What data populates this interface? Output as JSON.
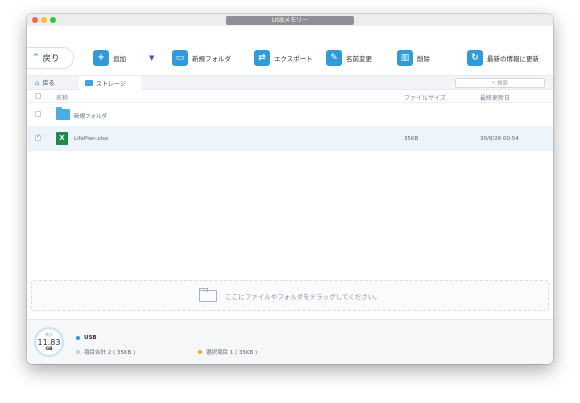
{
  "window": {
    "title": "USBメモリー"
  },
  "toolbar": {
    "back_label": "戻り",
    "add_label": "追加",
    "new_folder_label": "新規フォルダ",
    "export_label": "エクスポート",
    "rename_label": "名前変更",
    "delete_label": "削除",
    "refresh_label": "最新の情報に更新"
  },
  "pathbar": {
    "back_label": "戻る",
    "current_label": "ストレージ",
    "search_placeholder": "検索"
  },
  "table": {
    "headers": {
      "name": "名称",
      "size": "ファイルサイズ",
      "date": "最終更新日"
    },
    "rows": [
      {
        "name": "新規フォルダ",
        "size": "",
        "date": "",
        "icon": "folder-icon",
        "checked": false,
        "selected": false
      },
      {
        "name": "LifePlan.xlsx",
        "size": "35KB",
        "date": "30/8/26  00:54",
        "icon": "excel-file-icon",
        "checked": true,
        "selected": true
      }
    ]
  },
  "dropzone": {
    "text": "ここにファイルやフォルダをドラッグしてください。"
  },
  "status": {
    "gauge_label": "残り",
    "gauge_value": "11.83",
    "gauge_unit": "GB",
    "device_name": "USB",
    "total_items": "項目合計 2 ( 35KB )",
    "selected_items": "選択項目 1 ( 35KB )"
  },
  "colors": {
    "accent": "#2f9bdc",
    "device_dot": "#2f9bdc",
    "selected_dot": "#f5a623",
    "selected_row": "#edf4fa"
  }
}
